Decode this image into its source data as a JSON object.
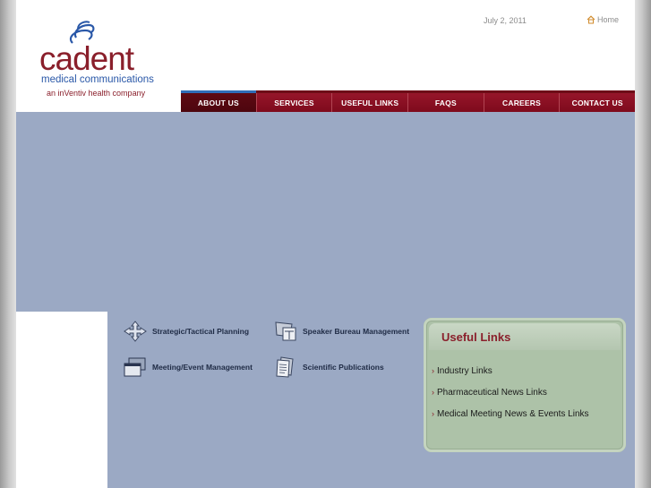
{
  "header": {
    "logo_word": "cadent",
    "logo_sub1": "medical communications",
    "logo_sub2": "an inVentiv health company",
    "date": "July 2, 2011",
    "home_label": "Home"
  },
  "nav": {
    "items": [
      {
        "label": "ABOUT US"
      },
      {
        "label": "SERVICES"
      },
      {
        "label": "USEFUL LINKS"
      },
      {
        "label": "FAQS"
      },
      {
        "label": "CAREERS"
      },
      {
        "label": "CONTACT US"
      }
    ],
    "active_index": 0
  },
  "services": [
    {
      "label": "Strategic/Tactical Planning",
      "icon": "arrows-icon"
    },
    {
      "label": "Speaker Bureau Management",
      "icon": "presentation-board-icon"
    },
    {
      "label": "Meeting/Event Management",
      "icon": "monitor-window-icon"
    },
    {
      "label": "Scientific Publications",
      "icon": "document-stack-icon"
    }
  ],
  "useful_links": {
    "title": "Useful Links",
    "items": [
      {
        "label": "Industry Links"
      },
      {
        "label": "Pharmaceutical News Links"
      },
      {
        "label": "Medical Meeting News & Events Links"
      }
    ]
  },
  "colors": {
    "brand_red": "#8a1f2b",
    "nav_red": "#8d0d20",
    "banner_blue": "#9ba9c4",
    "box_green": "#adc2a8"
  }
}
